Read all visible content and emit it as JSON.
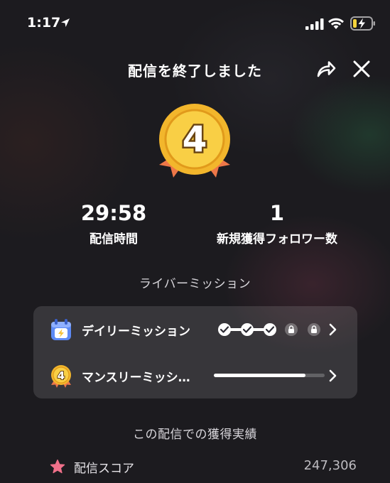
{
  "status_bar": {
    "time": "1:17"
  },
  "header": {
    "title": "配信を終了しました"
  },
  "medal": {
    "level": "4"
  },
  "stats": [
    {
      "value": "29:58",
      "label": "配信時間"
    },
    {
      "value": "1",
      "label": "新規獲得フォロワー数"
    }
  ],
  "missions": {
    "heading": "ライバーミッション",
    "daily": {
      "label": "デイリーミッション",
      "completed": 3,
      "locked": 2
    },
    "monthly": {
      "label": "マンスリーミッシ…",
      "badge": "4",
      "progress": 0.83
    }
  },
  "achievements": {
    "heading": "この配信での獲得実績",
    "score_label": "配信スコア",
    "score_value": "247,306"
  },
  "colors": {
    "background": "#1c1b1f",
    "medal_gold": "#f2b62c",
    "ribbon": "#ee7748",
    "calendar_blue": "#5d8af5",
    "star_pink": "#f0708a",
    "battery_yellow": "#f5d33b"
  }
}
